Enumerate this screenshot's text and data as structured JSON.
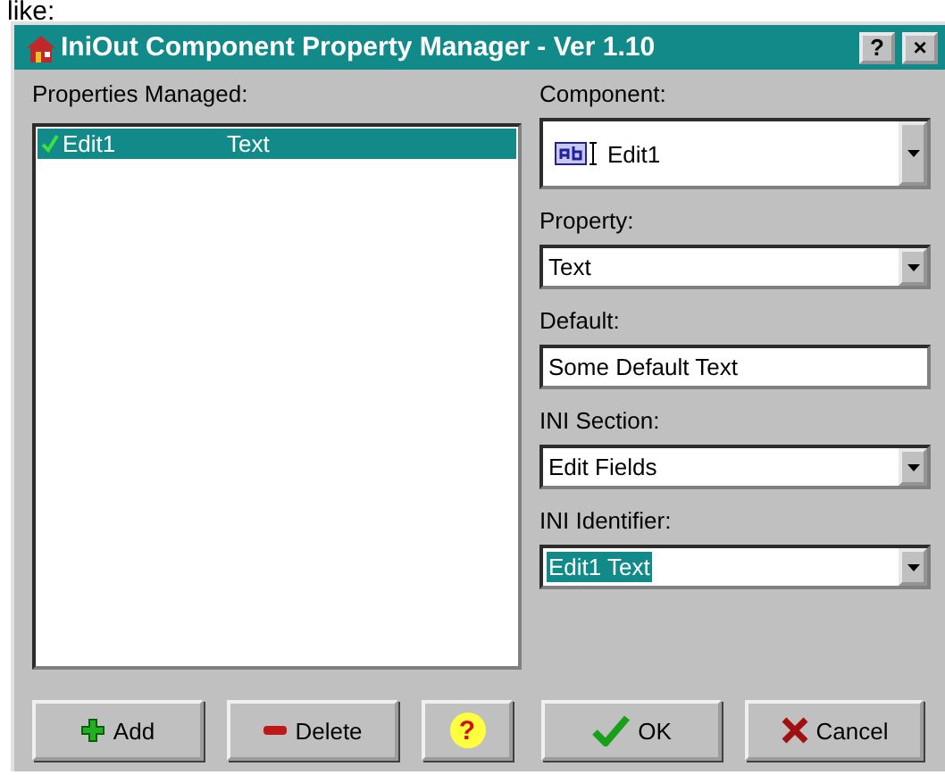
{
  "caption_above": "like:",
  "window": {
    "title": "IniOut Component Property Manager - Ver 1.10",
    "help_button": "?",
    "close_button": "×"
  },
  "properties": {
    "label": "Properties Managed:",
    "rows": [
      {
        "component": "Edit1",
        "property": "Text",
        "selected": true,
        "checked": true
      }
    ]
  },
  "fields": [
    {
      "kind": "component",
      "label": "Component:",
      "value": "Edit1",
      "highlighted": false
    },
    {
      "kind": "combo",
      "label": "Property:",
      "value": "Text",
      "highlighted": false
    },
    {
      "kind": "text",
      "label": "Default:",
      "value": "Some Default Text",
      "highlighted": false
    },
    {
      "kind": "combo",
      "label": "INI Section:",
      "value": "Edit Fields",
      "highlighted": false
    },
    {
      "kind": "combo",
      "label": "INI Identifier:",
      "value": "Edit1 Text",
      "highlighted": true
    }
  ],
  "buttons": [
    {
      "kind": "add",
      "label": "Add"
    },
    {
      "kind": "delete",
      "label": "Delete"
    },
    {
      "kind": "help",
      "label": "?"
    },
    {
      "kind": "ok",
      "label": "OK"
    },
    {
      "kind": "cancel",
      "label": "Cancel"
    }
  ]
}
